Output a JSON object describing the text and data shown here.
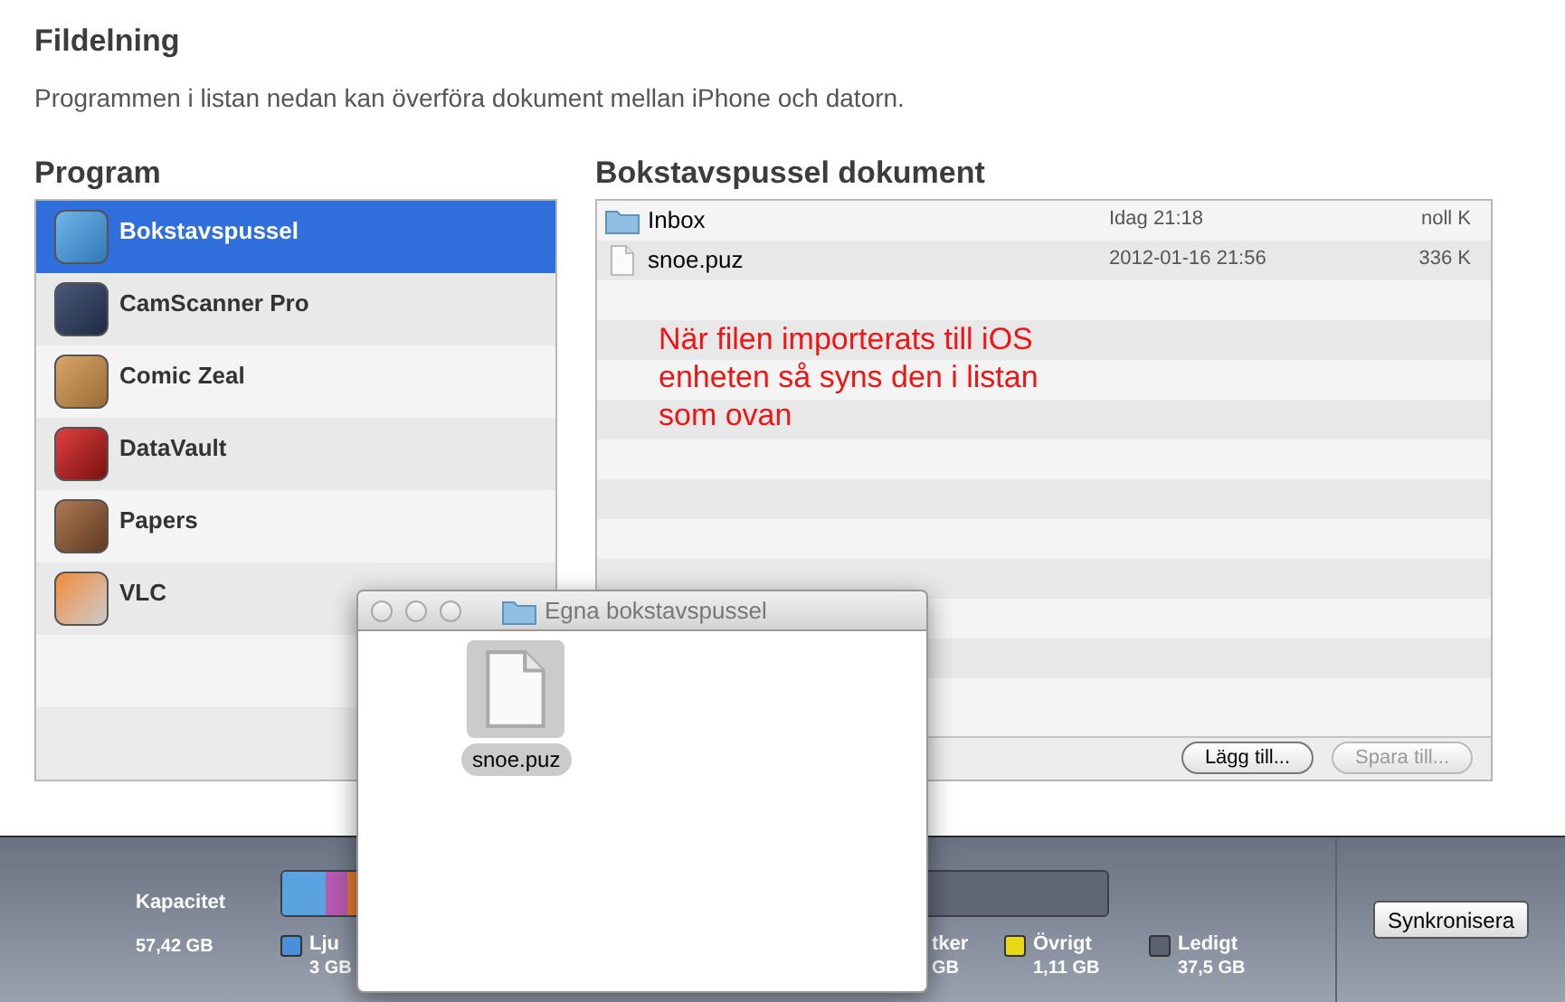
{
  "header": {
    "title": "Fildelning",
    "description": "Programmen i listan nedan kan överföra dokument mellan iPhone och datorn."
  },
  "apps": {
    "title": "Program",
    "items": [
      {
        "name": "Bokstavspussel",
        "selected": true
      },
      {
        "name": "CamScanner Pro",
        "selected": false
      },
      {
        "name": "Comic Zeal",
        "selected": false
      },
      {
        "name": "DataVault",
        "selected": false
      },
      {
        "name": "Papers",
        "selected": false
      },
      {
        "name": "VLC",
        "selected": false
      }
    ]
  },
  "documents": {
    "title": "Bokstavspussel dokument",
    "items": [
      {
        "kind": "folder",
        "name": "Inbox",
        "date": "Idag 21:18",
        "size": "noll K"
      },
      {
        "kind": "file",
        "name": "snoe.puz",
        "date": "2012-01-16 21:56",
        "size": "336 K"
      }
    ],
    "annotation_lines": [
      "När filen importerats till iOS",
      "enheten så syns den i listan",
      "som ovan"
    ],
    "buttons": [
      {
        "label": "Lägg till...",
        "disabled": false
      },
      {
        "label": "Spara till...",
        "disabled": true
      }
    ]
  },
  "finder_window": {
    "title": "Egna bokstavspussel",
    "items": [
      {
        "name": "snoe.puz",
        "selected": true
      }
    ]
  },
  "capacity": {
    "label": "Kapacitet",
    "total": "57,42 GB",
    "legend": [
      {
        "label": "Lju",
        "value": "3 GB",
        "color": "#4a90d9"
      },
      {
        "label": "tker",
        "value": "GB"
      },
      {
        "label": "Övrigt",
        "value": "1,11 GB",
        "color": "#e8d81a"
      },
      {
        "label": "Ledigt",
        "value": "37,5 GB",
        "color": "#5a6270"
      }
    ]
  },
  "sync_button": "Synkronisera"
}
